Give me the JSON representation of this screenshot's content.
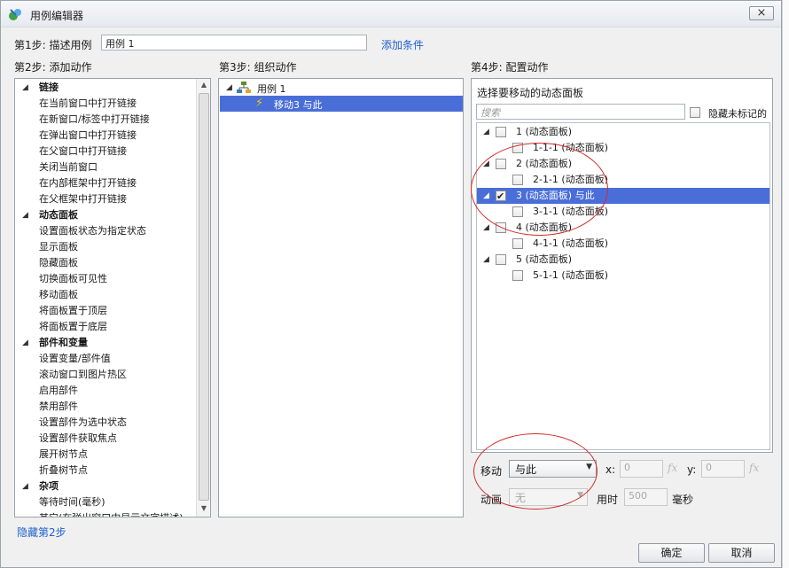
{
  "window": {
    "title": "用例编辑器",
    "close_label": "⨯"
  },
  "step1": {
    "label": "第1步: 描述用例",
    "name_value": "用例 1",
    "add_condition": "添加条件"
  },
  "step2": {
    "label": "第2步: 添加动作",
    "categories": [
      {
        "name": "链接",
        "items": [
          "在当前窗口中打开链接",
          "在新窗口/标签中打开链接",
          "在弹出窗口中打开链接",
          "在父窗口中打开链接",
          "关闭当前窗口",
          "在内部框架中打开链接",
          "在父框架中打开链接"
        ]
      },
      {
        "name": "动态面板",
        "items": [
          "设置面板状态为指定状态",
          "显示面板",
          "隐藏面板",
          "切换面板可见性",
          "移动面板",
          "将面板置于顶层",
          "将面板置于底层"
        ]
      },
      {
        "name": "部件和变量",
        "items": [
          "设置变量/部件值",
          "滚动窗口到图片热区",
          "启用部件",
          "禁用部件",
          "设置部件为选中状态",
          "设置部件获取焦点",
          "展开树节点",
          "折叠树节点"
        ]
      },
      {
        "name": "杂项",
        "items": [
          "等待时间(毫秒)",
          "其它(在弹出窗口中显示文字描述)"
        ]
      }
    ],
    "hide_link": "隐藏第2步"
  },
  "step3": {
    "label": "第3步: 组织动作",
    "case_name": "用例 1",
    "action": "移动3 与此"
  },
  "step4": {
    "label": "第4步: 配置动作",
    "header": "选择要移动的动态面板",
    "search_placeholder": "搜索",
    "hide_unmarked": "隐藏未标记的",
    "panels": [
      {
        "name": "1 (动态面板)",
        "child": "1-1-1 (动态面板)",
        "checked": false
      },
      {
        "name": "2 (动态面板)",
        "child": "2-1-1 (动态面板)",
        "checked": false
      },
      {
        "name": "3 (动态面板) 与此",
        "child": "3-1-1 (动态面板)",
        "checked": true
      },
      {
        "name": "4 (动态面板)",
        "child": "4-1-1 (动态面板)",
        "checked": false
      },
      {
        "name": "5 (动态面板)",
        "child": "5-1-1 (动态面板)",
        "checked": false
      }
    ],
    "move_label": "移动",
    "move_value": "与此",
    "x_label": "x:",
    "x_value": "0",
    "y_label": "y:",
    "y_value": "0",
    "anim_label": "动画",
    "anim_value": "无",
    "time_label": "用时",
    "time_value": "500",
    "ms_label": "毫秒"
  },
  "buttons": {
    "ok": "确定",
    "cancel": "取消"
  },
  "colors": {
    "link": "#1e5fcf",
    "selection": "#4a6ed8",
    "annotation": "#d42a2a"
  },
  "icons": {
    "app": "axure-logo-icon",
    "case": "case-tree-icon",
    "action": "lightning-icon",
    "fx": "fx-icon"
  }
}
